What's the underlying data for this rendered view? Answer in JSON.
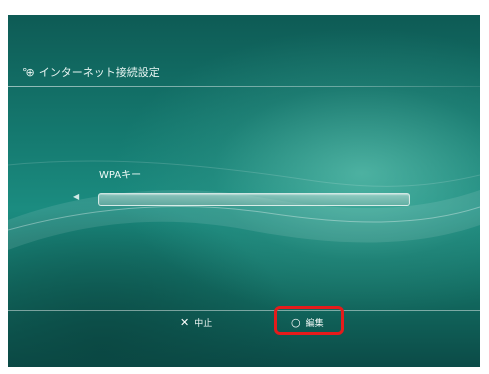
{
  "header": {
    "icon": "network-settings-icon",
    "icon_glyph": "°⊕",
    "title": "インターネット接続設定"
  },
  "form": {
    "field_label": "WPAキー",
    "left_arrow": "◀",
    "value": ""
  },
  "footer": {
    "cancel": {
      "icon": "cross-button-icon",
      "glyph": "✕",
      "label": "中止"
    },
    "edit": {
      "icon": "circle-button-icon",
      "glyph": "○",
      "label": "編集"
    }
  },
  "colors": {
    "background": "#157a70",
    "highlight": "#e51b1b",
    "text": "#f1fbf8"
  }
}
